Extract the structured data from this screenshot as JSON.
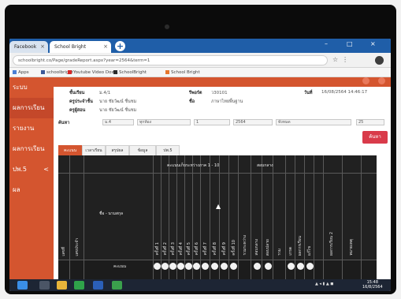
{
  "browser": {
    "tabs": [
      {
        "label": "Facebook"
      },
      {
        "label": "School Bright"
      }
    ],
    "new_tab_symbol": "+",
    "url": "schoolbright.co/Page/gradeReport.aspx?year=2564&term=1",
    "bookmarks": [
      {
        "label": "Apps"
      },
      {
        "label": "schoolbright"
      },
      {
        "label": "Youtube Video Dow..."
      },
      {
        "label": "SchoolBright"
      },
      {
        "label": "School Bright"
      }
    ]
  },
  "sidebar": {
    "items": [
      {
        "label": "ระบบ"
      },
      {
        "label": "ผลการเรียน"
      },
      {
        "label": "รายงาน"
      },
      {
        "label": "ผลการเรียน"
      },
      {
        "label": "ปพ.5"
      },
      {
        "label": "ผล"
      }
    ],
    "chevron": "<"
  },
  "header": {
    "class_label": "ชั้นเรียน",
    "class_value": "ม.4/1",
    "teacher_label": "ครูประจำชั้น",
    "teacher_value": "นาย ชัยวัฒน์ ชื่นชม",
    "assistant_label": "ครูผู้สอน",
    "assistant_value": "นาย ชัยวัฒน์ ชื่นชม",
    "subject_label": "รีพอร์ต",
    "subject_value": "ว30101",
    "course_label": "ชื่อ",
    "course_value": "ภาษาไทยพื้นฐาน",
    "date_label": "วันที่",
    "date_value": "16/08/2564 14:46:17",
    "filter_label": "ค้นหา",
    "filters": [
      {
        "value": "ม.4"
      },
      {
        "value": "ทุกห้อง"
      },
      {
        "value": "1"
      },
      {
        "value": "2564"
      },
      {
        "value": "ทั้งหมด"
      },
      {
        "value": "25"
      }
    ],
    "search_button": "ค้นหา"
  },
  "table": {
    "tabs": [
      {
        "label": "คะแนน"
      },
      {
        "label": "เวลาเรียน"
      },
      {
        "label": "สรุปผล"
      },
      {
        "label": "ข้อมูล"
      },
      {
        "label": "ปพ.5"
      }
    ],
    "group_title": "คะแนนเก็บระหว่างภาค 1 - 10",
    "group_title_2": "สอบกลาง",
    "left_headers": [
      "เลขที่",
      "เลขประจำ"
    ],
    "name_header": "ชื่อ - นามสกุล",
    "score_headers": [
      "ครั้งที่ 1",
      "ครั้งที่ 2",
      "ครั้งที่ 3",
      "ครั้งที่ 4",
      "ครั้งที่ 5",
      "ครั้งที่ 6",
      "ครั้งที่ 7",
      "ครั้งที่ 8",
      "ครั้งที่ 9",
      "ครั้งที่ 10"
    ],
    "right_headers": [
      "รวมระหว่าง",
      "สอบกลาง",
      "สอบปลาย",
      "รวม",
      "เกรด",
      "ผลการเรียน",
      "แก้ไข",
      "ผลการเรียน 2",
      "หมายเหตุ"
    ],
    "row_label": "คะแนน"
  },
  "taskbar": {
    "time": "15:48",
    "date": "16/8/2564"
  }
}
